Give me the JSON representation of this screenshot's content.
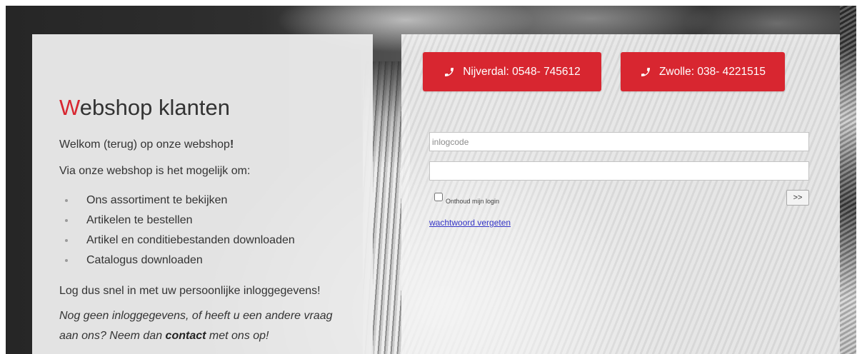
{
  "theme": {
    "accent": "#d82630",
    "text": "#333333",
    "link": "#3434c6"
  },
  "info_panel": {
    "title": {
      "first_letter": "W",
      "rest": "ebshop klanten"
    },
    "welcome": {
      "text": "Welkom (terug) op onze webshop",
      "exclamation": "!"
    },
    "intro": "Via onze webshop is het mogelijk om:",
    "features": [
      "Ons assortiment te bekijken",
      "Artikelen te bestellen",
      "Artikel en conditiebestanden downloaden",
      "Catalogus downloaden"
    ],
    "call_to_action": "Log dus snel in met uw persoonlijke inloggegevens!",
    "contact_note": {
      "line1": "Nog geen inloggegevens, of heeft u een andere vraag",
      "line2_before": "aan ons? Neem dan ",
      "link": "contact",
      "line2_after": " met ons op!"
    }
  },
  "login_panel": {
    "phone_buttons": [
      {
        "icon": "phone-icon",
        "label": "Nijverdal: 0548- 745612"
      },
      {
        "icon": "phone-icon",
        "label": "Zwolle: 038- 4221515"
      }
    ],
    "username_field": {
      "placeholder": "inlogcode",
      "value": ""
    },
    "password_field": {
      "value": ""
    },
    "remember_me": {
      "label": "Onthoud mijn login",
      "checked": false
    },
    "submit_label": ">>",
    "forgot_password_link": "wachtwoord vergeten"
  }
}
